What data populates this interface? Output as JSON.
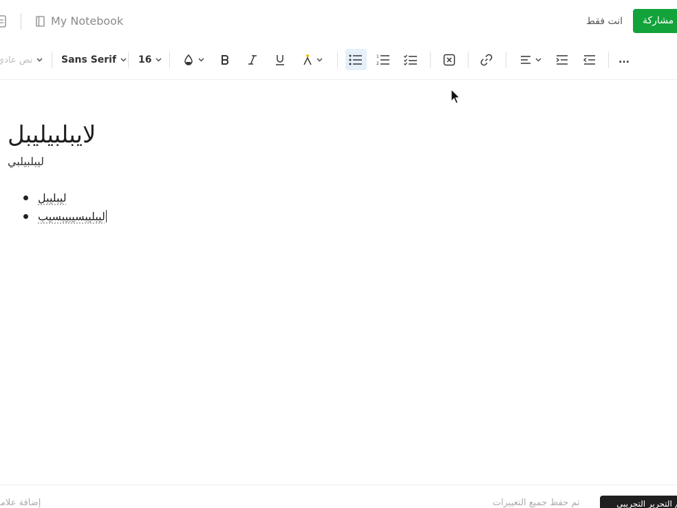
{
  "header": {
    "notebook_icon": "notebook-icon",
    "note_icon": "note-icon",
    "notebook_title": "My Notebook",
    "visibility": "انت فقط",
    "share_label": "مشاركة",
    "share_color": "#12a33a"
  },
  "toolbar": {
    "paragraph_style": "نص عادي",
    "font_family": "Sans Serif",
    "font_size": "16",
    "icons": [
      "text-color-icon",
      "bold-icon",
      "italic-icon",
      "underline-icon",
      "highlight-icon",
      "bulleted-list-icon",
      "numbered-list-icon",
      "checklist-icon",
      "clear-format-icon",
      "link-icon",
      "align-icon",
      "indent-icon",
      "outdent-icon",
      "more-icon"
    ],
    "more_label": "...",
    "active_color": "#e6f0fb"
  },
  "document": {
    "title": "لايبلبيليبل",
    "subtitle": "ليبلبيلبي",
    "bullets": [
      "ليبليبل",
      "ليبليبسيبيبسيب"
    ]
  },
  "footer": {
    "add_tag": "إضافة علامة",
    "saved_status": "تم حفظ جميع التغييرات",
    "trial_label": "تم التحرير التجريبي"
  }
}
